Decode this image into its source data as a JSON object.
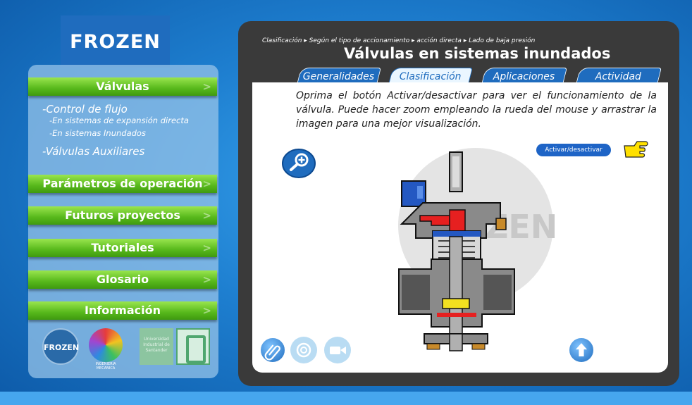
{
  "brand": {
    "logo_text": "FROZEN"
  },
  "sidebar": {
    "menu": [
      {
        "label": "Válvulas",
        "chevron": ">"
      },
      {
        "label": "Parámetros de operación",
        "chevron": ">"
      },
      {
        "label": "Futuros proyectos",
        "chevron": ">"
      },
      {
        "label": "Tutoriales",
        "chevron": ">"
      },
      {
        "label": "Glosario",
        "chevron": ">"
      },
      {
        "label": "Información",
        "chevron": ">"
      }
    ],
    "submenu": {
      "control_flujo": "-Control de flujo",
      "expansion_directa": "-En sistemas de expansión directa",
      "inundados": "-En sistemas Inundados",
      "auxiliares": "-Válvulas Auxiliares"
    },
    "partners": {
      "frozen": "FROZEN",
      "mecanica": "INGENIERIA MECANICA",
      "uis_text": "Universidad Industrial de Santander"
    }
  },
  "panel": {
    "breadcrumb": "Clasificación ▸ Según el tipo de accionamiento ▸ acción directa ▸ Lado de baja presión",
    "title": "Válvulas en sistemas inundados",
    "tabs": [
      {
        "label": "Generalidades",
        "active": false
      },
      {
        "label": "Clasificación",
        "active": true
      },
      {
        "label": "Aplicaciones",
        "active": false
      },
      {
        "label": "Actividad",
        "active": false
      }
    ],
    "instructions": "Oprima el botón Activar/desactivar para ver el funcionamiento de la válvula. Puede hacer zoom empleando la rueda del mouse y arrastrar la imagen para una mejor visualización.",
    "activate_label": "Activar/desactivar",
    "watermark": "ZEN"
  },
  "colors": {
    "accent_blue": "#1f6cbe",
    "menu_green": "#57b81b",
    "panel_dark": "#3a3a3a"
  },
  "icons": [
    "zoom-in-icon",
    "hand-pointer-icon",
    "paperclip-icon",
    "at-icon",
    "video-icon",
    "arrow-up-icon"
  ]
}
